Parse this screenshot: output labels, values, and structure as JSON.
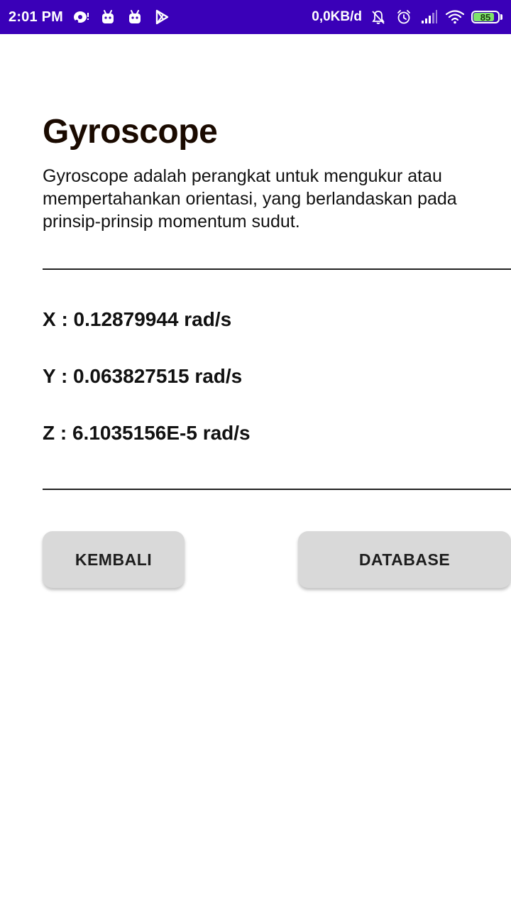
{
  "status_bar": {
    "time": "2:01 PM",
    "network_speed": "0,0KB/d",
    "battery_level": "85",
    "battery_fraction": 0.85,
    "background_color": "#3a00b8",
    "left_icons": [
      "pokeball-notification-icon",
      "android-notification-icon",
      "android-notification-icon",
      "play-store-notification-icon"
    ],
    "right_icons": [
      "mute-bell-icon",
      "alarm-clock-icon",
      "signal-bars-icon",
      "wifi-icon",
      "battery-icon"
    ]
  },
  "page": {
    "title": "Gyroscope",
    "description": "Gyroscope adalah perangkat untuk mengukur atau mempertahankan orientasi, yang berlandaskan pada prinsip-prinsip momentum sudut."
  },
  "readings": {
    "x": "X : 0.12879944 rad/s",
    "y": "Y : 0.063827515 rad/s",
    "z": "Z : 6.1035156E-5 rad/s"
  },
  "buttons": {
    "back_label": "KEMBALI",
    "database_label": "DATABASE",
    "color": "#d9d9d9"
  }
}
